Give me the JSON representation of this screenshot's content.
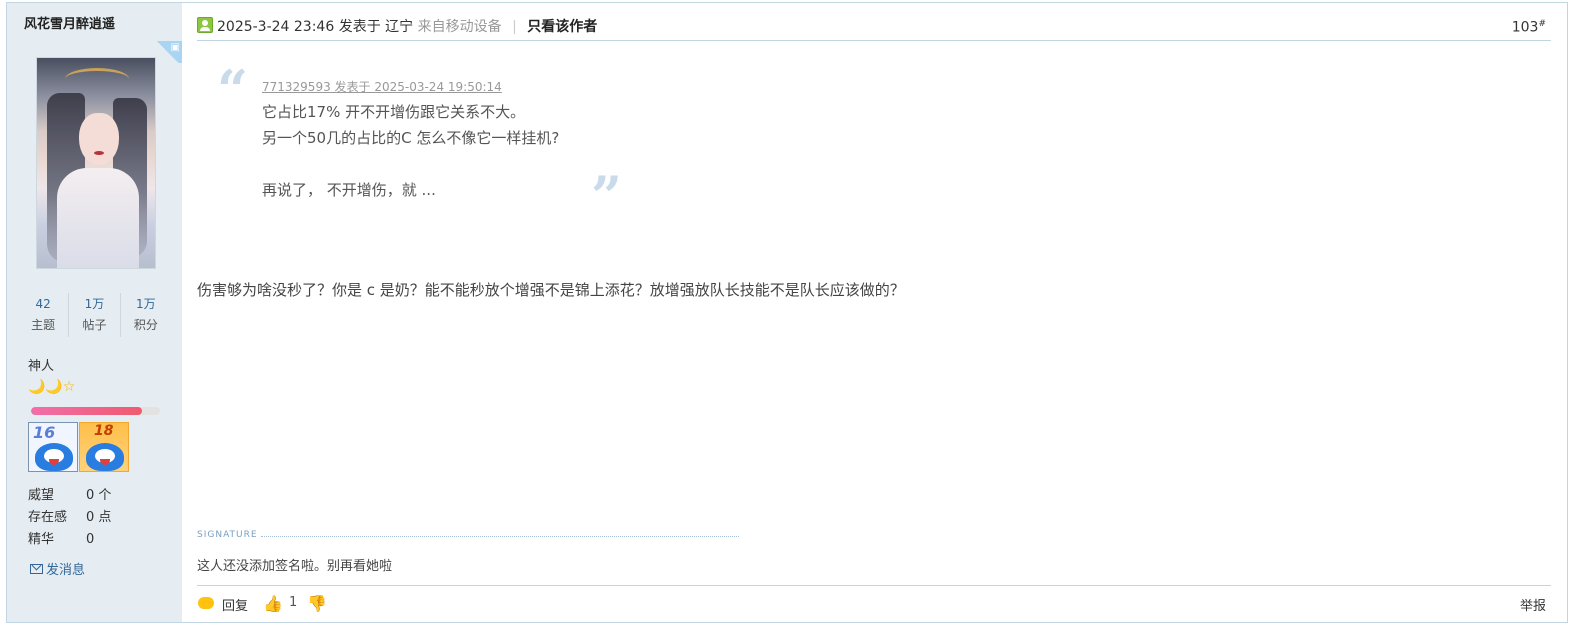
{
  "author": {
    "name": "风花雪月醉逍遥",
    "device_tag_icon": "android-icon",
    "stats": [
      {
        "value": "42",
        "label": "主题"
      },
      {
        "value": "1万",
        "label": "帖子"
      },
      {
        "value": "1万",
        "label": "积分"
      }
    ],
    "rank": "神人",
    "rank_stars": "🌙🌙☆",
    "level_progress": 0.86,
    "medals": [
      {
        "name": "medal-16",
        "text": "16"
      },
      {
        "name": "medal-18",
        "text": "18"
      }
    ],
    "props": [
      {
        "key": "威望",
        "value": "0 个"
      },
      {
        "key": "存在感",
        "value": "0 点"
      },
      {
        "key": "精华",
        "value": "0"
      }
    ],
    "send_message": "发消息"
  },
  "post": {
    "meta_time": "2025-3-24 23:46",
    "meta_posted_at": "发表于",
    "meta_location": "辽宁",
    "meta_device": "来自移动设备",
    "author_only": "只看该作者",
    "floor_number": "103",
    "floor_suffix": "#",
    "quote": {
      "meta": "771329593 发表于 2025-03-24 19:50:14",
      "line1": "它占比17%  开不开增伤跟它关系不大。",
      "line2": "另一个50几的占比的C 怎么不像它一样挂机?",
      "line3": "",
      "line4": "再说了， 不开增伤，就 ..."
    },
    "text": "伤害够为啥没秒了？你是 c 是奶？能不能秒放个增强不是锦上添花？放增强放队长技能不是队长应该做的？",
    "signature_label": "SIGNATURE",
    "signature": "这人还没添加签名啦。别再看她啦"
  },
  "footer": {
    "reply": "回复",
    "likes": "1",
    "report": "举报"
  },
  "colors": {
    "sidebar_bg": "#e5edf2",
    "border": "#c2d5e3",
    "link": "#336699",
    "progress": "#ef5a6f"
  }
}
